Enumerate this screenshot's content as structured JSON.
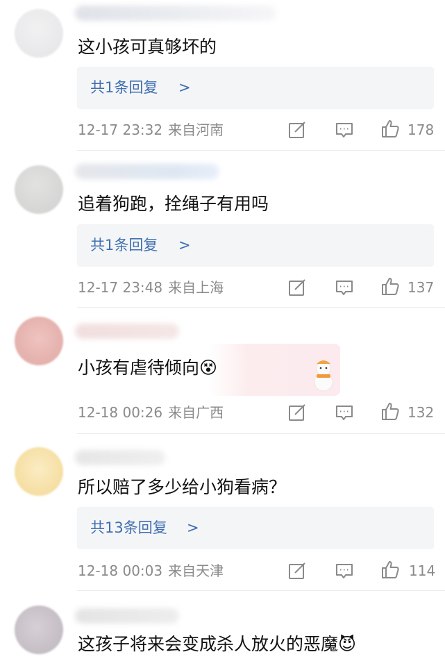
{
  "comments": [
    {
      "text": "这小孩可真够坏的",
      "reply_label": "共1条回复",
      "chevron": ">",
      "date": "12-17",
      "time": "23:32",
      "location": "来自河南",
      "likes": "178",
      "avatar_color": "#e9e9ea"
    },
    {
      "text": "追着狗跑，拴绳子有用吗",
      "reply_label": "共1条回复",
      "chevron": ">",
      "date": "12-17",
      "time": "23:48",
      "location": "来自上海",
      "likes": "137",
      "avatar_color": "#d6d8d6"
    },
    {
      "text": "小孩有虐待倾向😵",
      "date": "12-18",
      "time": "00:26",
      "location": "来自广西",
      "likes": "132",
      "avatar_color": "#e8b7b3"
    },
    {
      "text": "所以赔了多少给小狗看病？",
      "reply_label": "共13条回复",
      "chevron": ">",
      "date": "12-18",
      "time": "00:03",
      "location": "来自天津",
      "likes": "114",
      "avatar_color": "#f6dfa4"
    },
    {
      "text": "这孩子将来会变成杀人放火的恶魔😈",
      "avatar_color": "#cbc4cb"
    }
  ],
  "icons": [
    "edit-icon",
    "comment-icon",
    "thumbs-up-icon"
  ],
  "colors": {
    "link": "#3f6fb0",
    "meta": "#8a8a8a",
    "reply_bg": "#f4f5f7"
  }
}
